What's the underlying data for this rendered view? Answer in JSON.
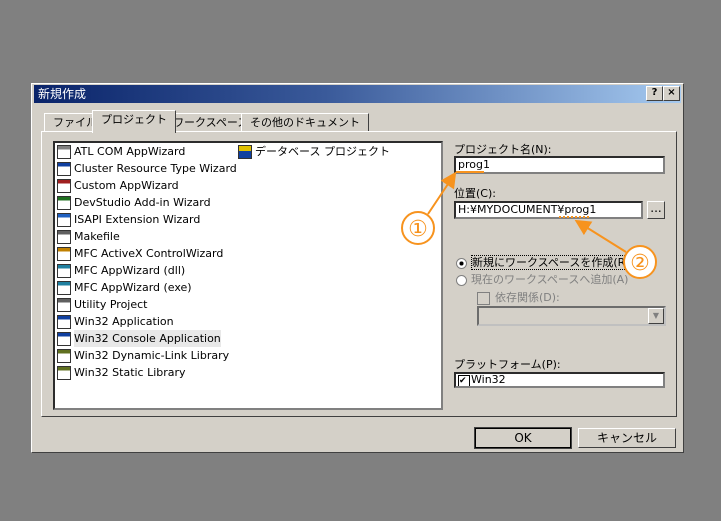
{
  "window": {
    "title": "新規作成",
    "help": "?",
    "close": "×"
  },
  "tabs": [
    {
      "label": "ファイル"
    },
    {
      "label": "プロジェクト"
    },
    {
      "label": "ワークスペース"
    },
    {
      "label": "その他のドキュメント"
    }
  ],
  "projects": [
    "ATL COM AppWizard",
    "Cluster Resource Type Wizard",
    "Custom AppWizard",
    "DevStudio Add-in Wizard",
    "ISAPI Extension Wizard",
    "Makefile",
    "MFC ActiveX ControlWizard",
    "MFC AppWizard (dll)",
    "MFC AppWizard (exe)",
    "Utility Project",
    "Win32 Application",
    "Win32 Console Application",
    "Win32 Dynamic-Link Library",
    "Win32 Static Library"
  ],
  "projects_col2": [
    "データベース プロジェクト"
  ],
  "selected_project": "Win32 Console Application",
  "project_name": {
    "label": "プロジェクト名(N):",
    "value": "prog1"
  },
  "location": {
    "label": "位置(C):",
    "value": "H:¥MYDOCUMENT¥prog1",
    "browse": "..."
  },
  "workspace": {
    "new": "新規にワークスペースを作成(R)",
    "add": "現在のワークスペースへ追加(A)",
    "dependency": "依存関係(D):",
    "selected": "new"
  },
  "platform": {
    "label": "プラットフォーム(P):",
    "item": "Win32",
    "checked": true
  },
  "buttons": {
    "ok": "OK",
    "cancel": "キャンセル"
  },
  "annotations": {
    "one": "①",
    "two": "②",
    "color": "#f7931e"
  }
}
